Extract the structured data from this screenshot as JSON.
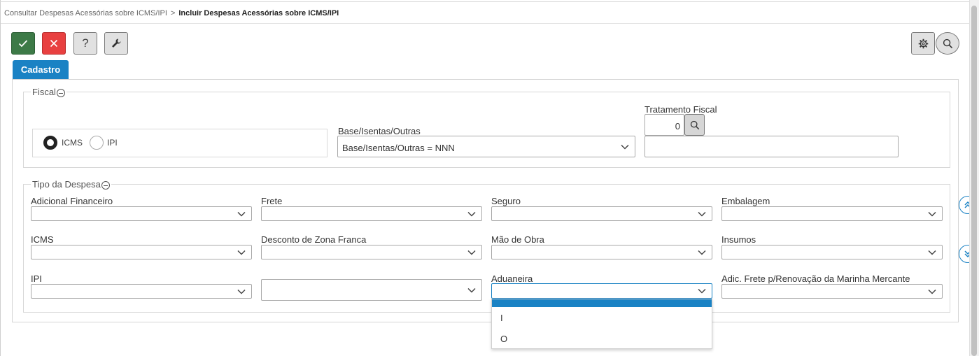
{
  "breadcrumb": {
    "parent": "Consultar Despesas Acessórias sobre ICMS/IPI",
    "separator": ">",
    "current": "Incluir Despesas Acessórias sobre ICMS/IPI"
  },
  "toolbar": {
    "confirm_icon": "check-icon",
    "cancel_icon": "close-icon",
    "help_label": "?",
    "tools_icon": "wrench-icon",
    "settings_icon": "gear-icon",
    "search_icon": "search-icon"
  },
  "tabs": [
    {
      "label": "Cadastro",
      "active": true
    }
  ],
  "fiscal": {
    "legend": "Fiscal",
    "radio_options": [
      {
        "label": "ICMS",
        "checked": true
      },
      {
        "label": "IPI",
        "checked": false
      }
    ],
    "base_label": "Base/Isentas/Outras",
    "base_value": "Base/Isentas/Outras = NNN",
    "tratamento_label": "Tratamento Fiscal",
    "tratamento_code": "0",
    "tratamento_desc": ""
  },
  "tipo": {
    "legend": "Tipo da Despesa",
    "fields": [
      {
        "label": "Adicional Financeiro",
        "value": ""
      },
      {
        "label": "Frete",
        "value": ""
      },
      {
        "label": "Seguro",
        "value": ""
      },
      {
        "label": "Embalagem",
        "value": ""
      },
      {
        "label": "ICMS",
        "value": ""
      },
      {
        "label": "Desconto de Zona Franca",
        "value": ""
      },
      {
        "label": "Mão de Obra",
        "value": ""
      },
      {
        "label": "Insumos",
        "value": ""
      },
      {
        "label": "IPI",
        "value": ""
      },
      {
        "label": "",
        "value": ""
      },
      {
        "label": "Aduaneira",
        "value": ""
      },
      {
        "label": "Adic. Frete p/Renovação da Marinha Mercante",
        "value": ""
      }
    ]
  },
  "dropdown": {
    "options": [
      "",
      "I",
      "O"
    ],
    "highlighted_index": 0
  },
  "colors": {
    "primary": "#1a82c4",
    "confirm": "#3d7a47",
    "cancel": "#e84040"
  }
}
